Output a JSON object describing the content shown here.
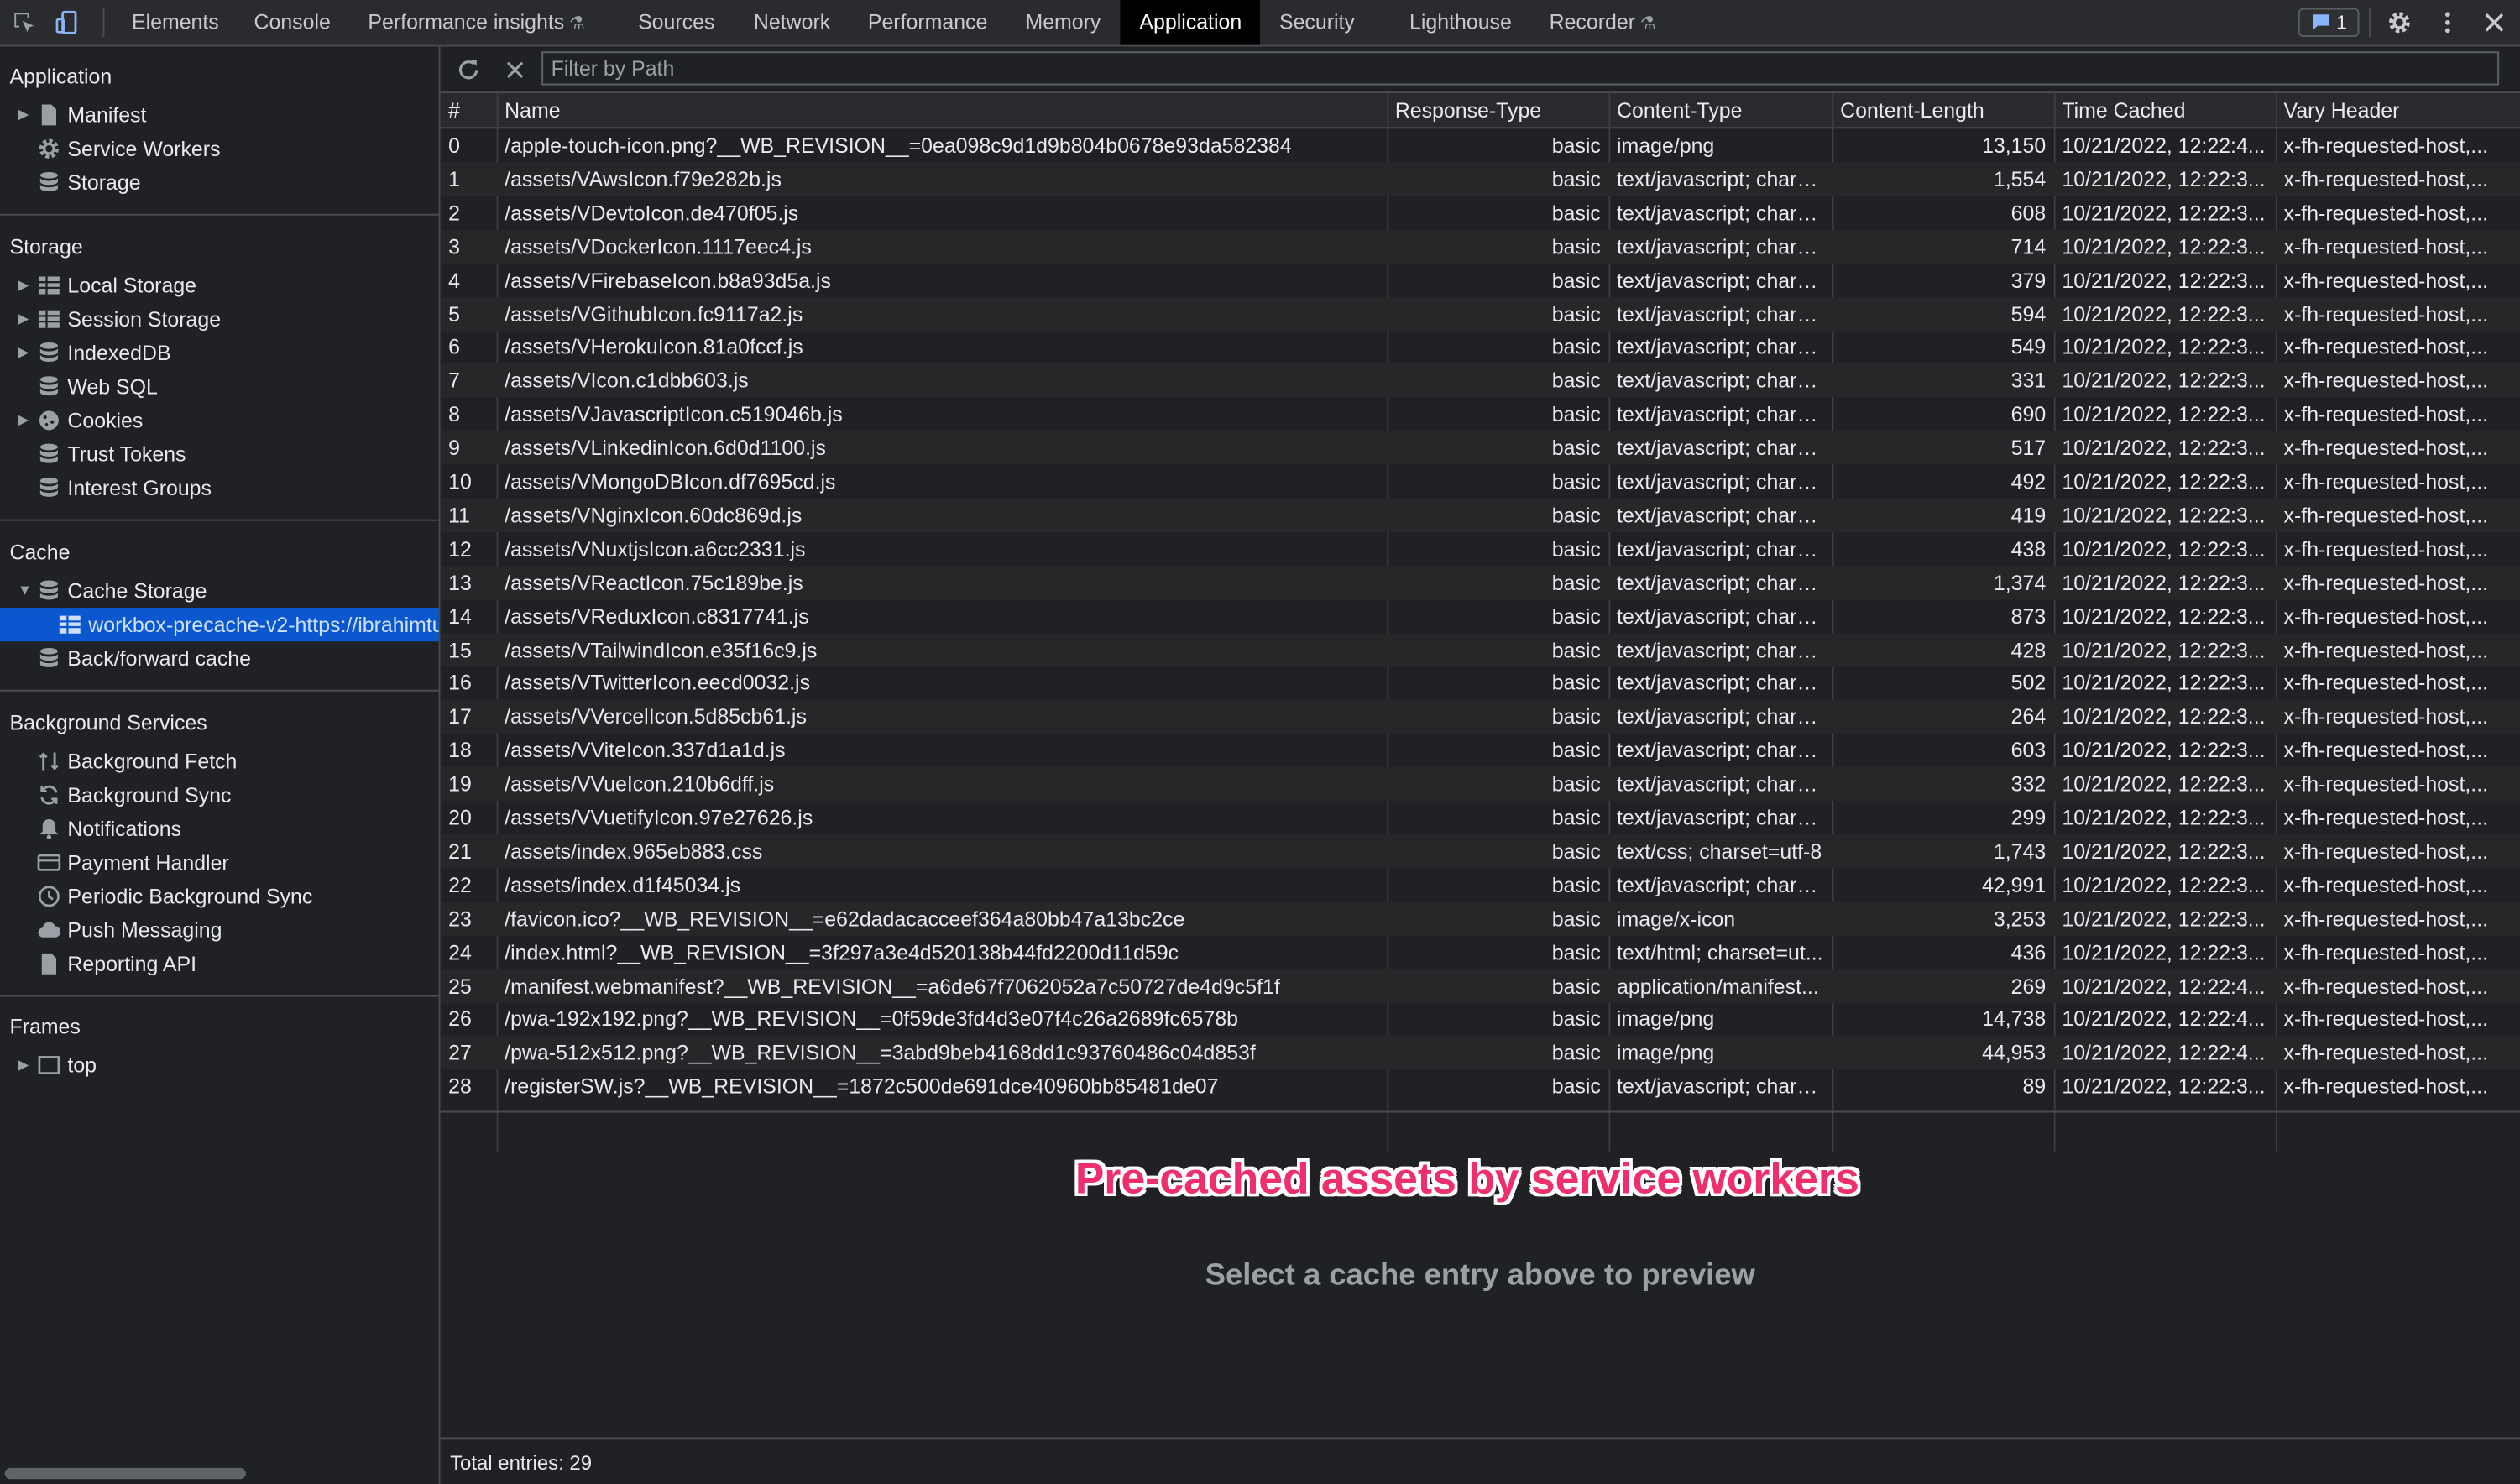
{
  "toolbar": {
    "tabs": [
      {
        "label": "Elements"
      },
      {
        "label": "Console"
      },
      {
        "label": "Performance insights"
      },
      {
        "label": "Sources"
      },
      {
        "label": "Network"
      },
      {
        "label": "Performance"
      },
      {
        "label": "Memory"
      },
      {
        "label": "Application"
      },
      {
        "label": "Security"
      },
      {
        "label": "Lighthouse"
      },
      {
        "label": "Recorder"
      }
    ],
    "active_tab": "Application",
    "issues_count": "1",
    "colors": {
      "accent": "#0b57d0",
      "active_tab_bg": "#000000"
    }
  },
  "sidebar": {
    "application": {
      "title": "Application",
      "items": [
        {
          "label": "Manifest",
          "icon": "document-icon"
        },
        {
          "label": "Service Workers",
          "icon": "gear-icon"
        },
        {
          "label": "Storage",
          "icon": "database-icon"
        }
      ]
    },
    "storage": {
      "title": "Storage",
      "items": [
        {
          "label": "Local Storage",
          "icon": "grid-icon"
        },
        {
          "label": "Session Storage",
          "icon": "grid-icon"
        },
        {
          "label": "IndexedDB",
          "icon": "database-icon"
        },
        {
          "label": "Web SQL",
          "icon": "database-icon"
        },
        {
          "label": "Cookies",
          "icon": "cookie-icon"
        },
        {
          "label": "Trust Tokens",
          "icon": "database-icon"
        },
        {
          "label": "Interest Groups",
          "icon": "database-icon"
        }
      ]
    },
    "cache": {
      "title": "Cache",
      "items": [
        {
          "label": "Cache Storage",
          "icon": "database-icon"
        },
        {
          "label": "workbox-precache-v2-https://ibrahimtu",
          "icon": "grid-icon"
        },
        {
          "label": "Back/forward cache",
          "icon": "database-icon"
        }
      ]
    },
    "background": {
      "title": "Background Services",
      "items": [
        {
          "label": "Background Fetch",
          "icon": "fetch-arrows-icon"
        },
        {
          "label": "Background Sync",
          "icon": "sync-icon"
        },
        {
          "label": "Notifications",
          "icon": "bell-icon"
        },
        {
          "label": "Payment Handler",
          "icon": "card-icon"
        },
        {
          "label": "Periodic Background Sync",
          "icon": "clock-icon"
        },
        {
          "label": "Push Messaging",
          "icon": "cloud-icon"
        },
        {
          "label": "Reporting API",
          "icon": "document-icon"
        }
      ]
    },
    "frames": {
      "title": "Frames",
      "items": [
        {
          "label": "top",
          "icon": "frame-icon"
        }
      ]
    }
  },
  "filter": {
    "placeholder": "Filter by Path",
    "value": ""
  },
  "table": {
    "columns": [
      "#",
      "Name",
      "Response-Type",
      "Content-Type",
      "Content-Length",
      "Time Cached",
      "Vary Header"
    ],
    "rows": [
      [
        "0",
        "/apple-touch-icon.png?__WB_REVISION__=0ea098c9d1d9b804b0678e93da582384",
        "basic",
        "image/png",
        "13,150",
        "10/21/2022, 12:22:4...",
        "x-fh-requested-host,..."
      ],
      [
        "1",
        "/assets/VAwsIcon.f79e282b.js",
        "basic",
        "text/javascript; chars...",
        "1,554",
        "10/21/2022, 12:22:3...",
        "x-fh-requested-host,..."
      ],
      [
        "2",
        "/assets/VDevtoIcon.de470f05.js",
        "basic",
        "text/javascript; chars...",
        "608",
        "10/21/2022, 12:22:3...",
        "x-fh-requested-host,..."
      ],
      [
        "3",
        "/assets/VDockerIcon.1117eec4.js",
        "basic",
        "text/javascript; chars...",
        "714",
        "10/21/2022, 12:22:3...",
        "x-fh-requested-host,..."
      ],
      [
        "4",
        "/assets/VFirebaseIcon.b8a93d5a.js",
        "basic",
        "text/javascript; chars...",
        "379",
        "10/21/2022, 12:22:3...",
        "x-fh-requested-host,..."
      ],
      [
        "5",
        "/assets/VGithubIcon.fc9117a2.js",
        "basic",
        "text/javascript; chars...",
        "594",
        "10/21/2022, 12:22:3...",
        "x-fh-requested-host,..."
      ],
      [
        "6",
        "/assets/VHerokuIcon.81a0fccf.js",
        "basic",
        "text/javascript; chars...",
        "549",
        "10/21/2022, 12:22:3...",
        "x-fh-requested-host,..."
      ],
      [
        "7",
        "/assets/VIcon.c1dbb603.js",
        "basic",
        "text/javascript; chars...",
        "331",
        "10/21/2022, 12:22:3...",
        "x-fh-requested-host,..."
      ],
      [
        "8",
        "/assets/VJavascriptIcon.c519046b.js",
        "basic",
        "text/javascript; chars...",
        "690",
        "10/21/2022, 12:22:3...",
        "x-fh-requested-host,..."
      ],
      [
        "9",
        "/assets/VLinkedinIcon.6d0d1100.js",
        "basic",
        "text/javascript; chars...",
        "517",
        "10/21/2022, 12:22:3...",
        "x-fh-requested-host,..."
      ],
      [
        "10",
        "/assets/VMongoDBIcon.df7695cd.js",
        "basic",
        "text/javascript; chars...",
        "492",
        "10/21/2022, 12:22:3...",
        "x-fh-requested-host,..."
      ],
      [
        "11",
        "/assets/VNginxIcon.60dc869d.js",
        "basic",
        "text/javascript; chars...",
        "419",
        "10/21/2022, 12:22:3...",
        "x-fh-requested-host,..."
      ],
      [
        "12",
        "/assets/VNuxtjsIcon.a6cc2331.js",
        "basic",
        "text/javascript; chars...",
        "438",
        "10/21/2022, 12:22:3...",
        "x-fh-requested-host,..."
      ],
      [
        "13",
        "/assets/VReactIcon.75c189be.js",
        "basic",
        "text/javascript; chars...",
        "1,374",
        "10/21/2022, 12:22:3...",
        "x-fh-requested-host,..."
      ],
      [
        "14",
        "/assets/VReduxIcon.c8317741.js",
        "basic",
        "text/javascript; chars...",
        "873",
        "10/21/2022, 12:22:3...",
        "x-fh-requested-host,..."
      ],
      [
        "15",
        "/assets/VTailwindIcon.e35f16c9.js",
        "basic",
        "text/javascript; chars...",
        "428",
        "10/21/2022, 12:22:3...",
        "x-fh-requested-host,..."
      ],
      [
        "16",
        "/assets/VTwitterIcon.eecd0032.js",
        "basic",
        "text/javascript; chars...",
        "502",
        "10/21/2022, 12:22:3...",
        "x-fh-requested-host,..."
      ],
      [
        "17",
        "/assets/VVercelIcon.5d85cb61.js",
        "basic",
        "text/javascript; chars...",
        "264",
        "10/21/2022, 12:22:3...",
        "x-fh-requested-host,..."
      ],
      [
        "18",
        "/assets/VViteIcon.337d1a1d.js",
        "basic",
        "text/javascript; chars...",
        "603",
        "10/21/2022, 12:22:3...",
        "x-fh-requested-host,..."
      ],
      [
        "19",
        "/assets/VVueIcon.210b6dff.js",
        "basic",
        "text/javascript; chars...",
        "332",
        "10/21/2022, 12:22:3...",
        "x-fh-requested-host,..."
      ],
      [
        "20",
        "/assets/VVuetifyIcon.97e27626.js",
        "basic",
        "text/javascript; chars...",
        "299",
        "10/21/2022, 12:22:3...",
        "x-fh-requested-host,..."
      ],
      [
        "21",
        "/assets/index.965eb883.css",
        "basic",
        "text/css; charset=utf-8",
        "1,743",
        "10/21/2022, 12:22:3...",
        "x-fh-requested-host,..."
      ],
      [
        "22",
        "/assets/index.d1f45034.js",
        "basic",
        "text/javascript; chars...",
        "42,991",
        "10/21/2022, 12:22:3...",
        "x-fh-requested-host,..."
      ],
      [
        "23",
        "/favicon.ico?__WB_REVISION__=e62dadacacceef364a80bb47a13bc2ce",
        "basic",
        "image/x-icon",
        "3,253",
        "10/21/2022, 12:22:3...",
        "x-fh-requested-host,..."
      ],
      [
        "24",
        "/index.html?__WB_REVISION__=3f297a3e4d520138b44fd2200d11d59c",
        "basic",
        "text/html; charset=ut...",
        "436",
        "10/21/2022, 12:22:3...",
        "x-fh-requested-host,..."
      ],
      [
        "25",
        "/manifest.webmanifest?__WB_REVISION__=a6de67f7062052a7c50727de4d9c5f1f",
        "basic",
        "application/manifest...",
        "269",
        "10/21/2022, 12:22:4...",
        "x-fh-requested-host,..."
      ],
      [
        "26",
        "/pwa-192x192.png?__WB_REVISION__=0f59de3fd4d3e07f4c26a2689fc6578b",
        "basic",
        "image/png",
        "14,738",
        "10/21/2022, 12:22:4...",
        "x-fh-requested-host,..."
      ],
      [
        "27",
        "/pwa-512x512.png?__WB_REVISION__=3abd9beb4168dd1c93760486c04d853f",
        "basic",
        "image/png",
        "44,953",
        "10/21/2022, 12:22:4...",
        "x-fh-requested-host,..."
      ],
      [
        "28",
        "/registerSW.js?__WB_REVISION__=1872c500de691dce40960bb85481de07",
        "basic",
        "text/javascript; chars...",
        "89",
        "10/21/2022, 12:22:3...",
        "x-fh-requested-host,..."
      ]
    ]
  },
  "preview": {
    "annotation": "Pre-cached assets by service workers",
    "message": "Select a cache entry above to preview",
    "annotation_color": "#ef2f6b"
  },
  "status": {
    "total": "Total entries: 29"
  }
}
